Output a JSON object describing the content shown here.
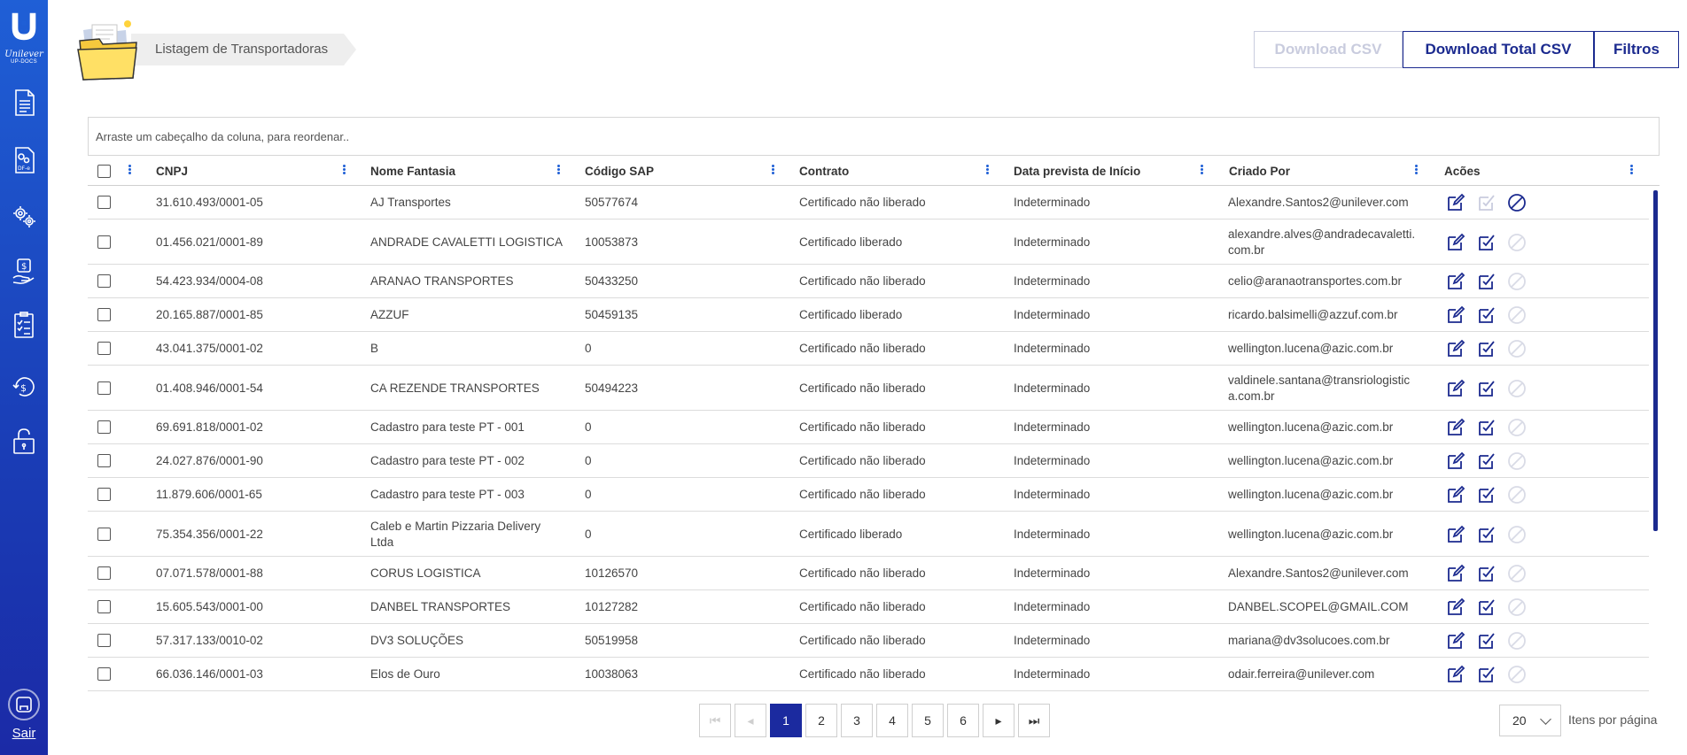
{
  "app": {
    "brand": "Unilever",
    "brand_sub": "UP-DOCS",
    "exit_label": "Sair"
  },
  "sidebar": {
    "icons": [
      "document-icon",
      "dfe-document-icon",
      "settings-gears-icon",
      "money-hand-icon",
      "checklist-icon",
      "refund-icon",
      "lock-icon"
    ]
  },
  "header": {
    "breadcrumb": "Listagem de Transportadoras",
    "buttons": {
      "download_csv": "Download CSV",
      "download_total_csv": "Download Total CSV",
      "filters": "Filtros"
    }
  },
  "grid": {
    "group_hint": "Arraste um cabeçalho da coluna, para reordenar..",
    "columns": [
      "CNPJ",
      "Nome Fantasia",
      "Código SAP",
      "Contrato",
      "Data prevista de Início",
      "Criado Por",
      "Acões"
    ],
    "rows": [
      {
        "cnpj": "31.610.493/0001-05",
        "nome": [
          "AJ Transportes"
        ],
        "sap": "50577674",
        "contrato": "Certificado não liberado",
        "data": "Indeterminado",
        "criado": [
          "Alexandre.Santos2@unilever.com"
        ],
        "can_approve": false,
        "can_block": true
      },
      {
        "cnpj": "01.456.021/0001-89",
        "nome": [
          "ANDRADE CAVALETTI LOGISTICA"
        ],
        "sap": "10053873",
        "contrato": "Certificado liberado",
        "data": "Indeterminado",
        "criado": [
          "alexandre.alves@andradecavaletti.",
          "com.br"
        ],
        "can_approve": true,
        "can_block": false
      },
      {
        "cnpj": "54.423.934/0004-08",
        "nome": [
          "ARANAO TRANSPORTES"
        ],
        "sap": "50433250",
        "contrato": "Certificado não liberado",
        "data": "Indeterminado",
        "criado": [
          "celio@aranaotransportes.com.br"
        ],
        "can_approve": true,
        "can_block": false
      },
      {
        "cnpj": "20.165.887/0001-85",
        "nome": [
          "AZZUF"
        ],
        "sap": "50459135",
        "contrato": "Certificado liberado",
        "data": "Indeterminado",
        "criado": [
          "ricardo.balsimelli@azzuf.com.br"
        ],
        "can_approve": true,
        "can_block": false
      },
      {
        "cnpj": "43.041.375/0001-02",
        "nome": [
          "B"
        ],
        "sap": "0",
        "contrato": "Certificado não liberado",
        "data": "Indeterminado",
        "criado": [
          "wellington.lucena@azic.com.br"
        ],
        "can_approve": true,
        "can_block": false
      },
      {
        "cnpj": "01.408.946/0001-54",
        "nome": [
          "CA REZENDE TRANSPORTES"
        ],
        "sap": "50494223",
        "contrato": "Certificado não liberado",
        "data": "Indeterminado",
        "criado": [
          "valdinele.santana@transriologistic",
          "a.com.br"
        ],
        "can_approve": true,
        "can_block": false
      },
      {
        "cnpj": "69.691.818/0001-02",
        "nome": [
          "Cadastro para teste PT - 001"
        ],
        "sap": "0",
        "contrato": "Certificado não liberado",
        "data": "Indeterminado",
        "criado": [
          "wellington.lucena@azic.com.br"
        ],
        "can_approve": true,
        "can_block": false
      },
      {
        "cnpj": "24.027.876/0001-90",
        "nome": [
          "Cadastro para teste PT - 002"
        ],
        "sap": "0",
        "contrato": "Certificado não liberado",
        "data": "Indeterminado",
        "criado": [
          "wellington.lucena@azic.com.br"
        ],
        "can_approve": true,
        "can_block": false
      },
      {
        "cnpj": "11.879.606/0001-65",
        "nome": [
          "Cadastro para teste PT - 003"
        ],
        "sap": "0",
        "contrato": "Certificado não liberado",
        "data": "Indeterminado",
        "criado": [
          "wellington.lucena@azic.com.br"
        ],
        "can_approve": true,
        "can_block": false
      },
      {
        "cnpj": "75.354.356/0001-22",
        "nome": [
          "Caleb e Martin Pizzaria Delivery",
          "Ltda"
        ],
        "sap": "0",
        "contrato": "Certificado liberado",
        "data": "Indeterminado",
        "criado": [
          "wellington.lucena@azic.com.br"
        ],
        "can_approve": true,
        "can_block": false
      },
      {
        "cnpj": "07.071.578/0001-88",
        "nome": [
          "CORUS LOGISTICA"
        ],
        "sap": "10126570",
        "contrato": "Certificado não liberado",
        "data": "Indeterminado",
        "criado": [
          "Alexandre.Santos2@unilever.com"
        ],
        "can_approve": true,
        "can_block": false
      },
      {
        "cnpj": "15.605.543/0001-00",
        "nome": [
          "DANBEL TRANSPORTES"
        ],
        "sap": "10127282",
        "contrato": "Certificado não liberado",
        "data": "Indeterminado",
        "criado": [
          "DANBEL.SCOPEL@GMAIL.COM"
        ],
        "can_approve": true,
        "can_block": false
      },
      {
        "cnpj": "57.317.133/0010-02",
        "nome": [
          "DV3 SOLUÇÕES"
        ],
        "sap": "50519958",
        "contrato": "Certificado não liberado",
        "data": "Indeterminado",
        "criado": [
          "mariana@dv3solucoes.com.br"
        ],
        "can_approve": true,
        "can_block": false
      },
      {
        "cnpj": "66.036.146/0001-03",
        "nome": [
          "Elos de Ouro"
        ],
        "sap": "10038063",
        "contrato": "Certificado não liberado",
        "data": "Indeterminado",
        "criado": [
          "odair.ferreira@unilever.com"
        ],
        "can_approve": true,
        "can_block": false
      }
    ]
  },
  "pagination": {
    "pages": [
      "1",
      "2",
      "3",
      "4",
      "5",
      "6"
    ],
    "current": "1",
    "first": "⏮",
    "prev": "◂",
    "next": "▸",
    "last": "⏭",
    "page_size": "20",
    "page_size_label": "Itens por página"
  },
  "colors": {
    "primary": "#1b2a9f",
    "sidebar": "#1f5fd6",
    "action_blue": "#1b2a8f",
    "disabled": "#c9ccde"
  }
}
